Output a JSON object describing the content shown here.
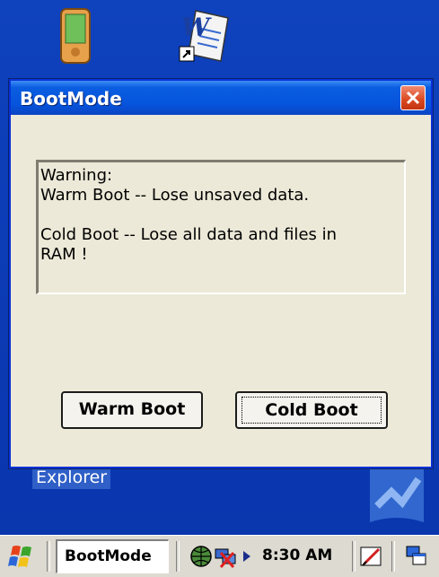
{
  "desktop": {
    "explorer_label": "Explorer"
  },
  "dialog": {
    "title": "BootMode",
    "warning_lines": [
      "Warning:",
      "Warm Boot -- Lose unsaved data.",
      "",
      "Cold Boot -- Lose all data and files in",
      "RAM !"
    ],
    "warm_boot_label": "Warm Boot",
    "cold_boot_label": "Cold Boot"
  },
  "taskbar": {
    "active_app": "BootMode",
    "clock": "8:30 AM"
  },
  "colors": {
    "desktop": "#0b3bb8",
    "titlebar": "#0654dc",
    "dialog_bg": "#ece9d8",
    "close": "#d9481f"
  }
}
